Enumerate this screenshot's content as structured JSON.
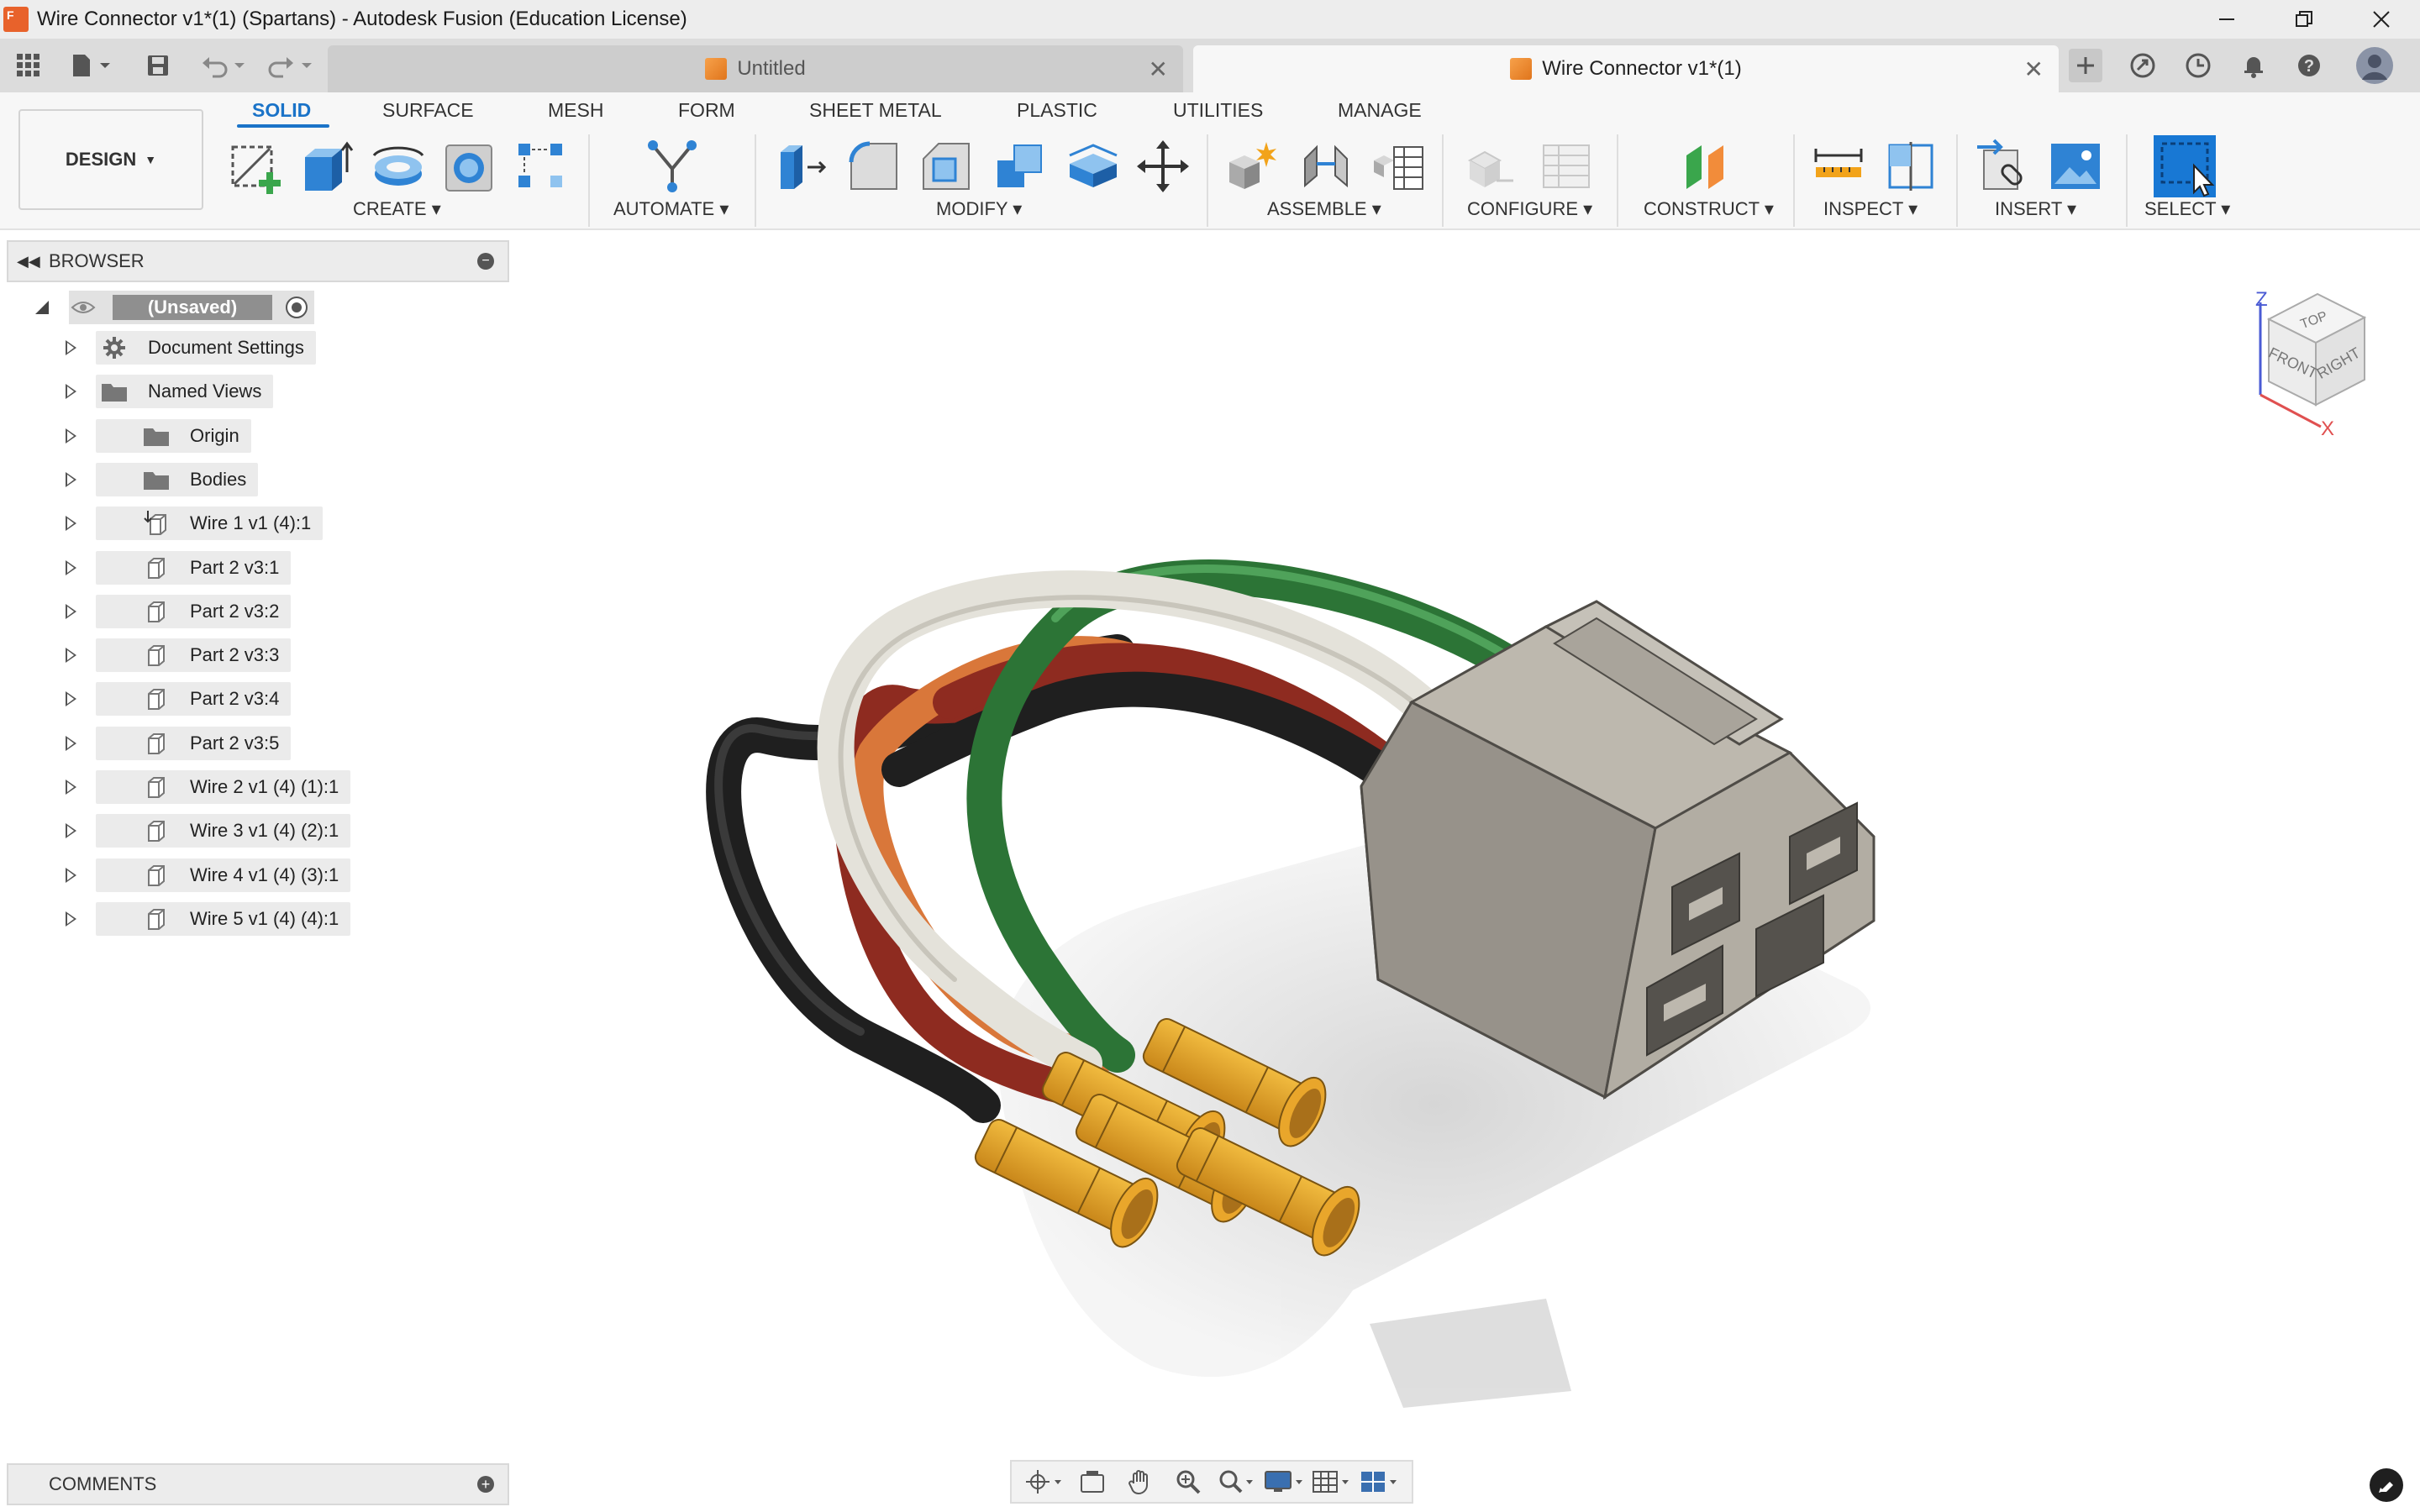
{
  "window": {
    "title": "Wire Connector v1*(1) (Spartans) - Autodesk Fusion (Education License)",
    "app_logo_text": "F",
    "controls": [
      "minimize",
      "restore",
      "close"
    ]
  },
  "document_tabs": [
    {
      "label": "Untitled",
      "active": false
    },
    {
      "label": "Wire Connector v1*(1)",
      "active": true
    }
  ],
  "quick_access": {
    "icons": [
      "app-grid-icon",
      "file-icon",
      "save-icon",
      "undo-icon",
      "redo-icon"
    ],
    "right_icons": [
      "new-tab-icon",
      "extensions-icon",
      "job-status-icon",
      "notifications-icon",
      "help-icon",
      "user-avatar"
    ]
  },
  "workspace": {
    "label": "DESIGN",
    "tabs": [
      "SOLID",
      "SURFACE",
      "MESH",
      "FORM",
      "SHEET METAL",
      "PLASTIC",
      "UTILITIES",
      "MANAGE"
    ],
    "active_tab": "SOLID"
  },
  "toolbar_groups": [
    {
      "label": "CREATE",
      "tools": [
        "create-sketch",
        "extrude",
        "revolve",
        "hole",
        "pattern"
      ]
    },
    {
      "label": "AUTOMATE",
      "tools": [
        "automate"
      ]
    },
    {
      "label": "MODIFY",
      "tools": [
        "press-pull",
        "fillet",
        "chamfer",
        "combine",
        "shell",
        "move"
      ]
    },
    {
      "label": "ASSEMBLE",
      "tools": [
        "new-component",
        "joint",
        "table"
      ]
    },
    {
      "label": "CONFIGURE",
      "tools": [
        "configure-a",
        "configure-b"
      ]
    },
    {
      "label": "CONSTRUCT",
      "tools": [
        "offset-plane"
      ]
    },
    {
      "label": "INSPECT",
      "tools": [
        "measure",
        "interference"
      ]
    },
    {
      "label": "INSERT",
      "tools": [
        "insert-derive",
        "insert-image"
      ]
    },
    {
      "label": "SELECT",
      "tools": [
        "select"
      ]
    }
  ],
  "browser": {
    "title": "BROWSER",
    "root": "(Unsaved)",
    "items": [
      {
        "label": "Document Settings",
        "icon": "gear-icon",
        "eye": false
      },
      {
        "label": "Named Views",
        "icon": "folder-icon",
        "eye": false
      },
      {
        "label": "Origin",
        "icon": "folder-icon",
        "eye": "hidden"
      },
      {
        "label": "Bodies",
        "icon": "folder-icon",
        "eye": true
      },
      {
        "label": "Wire 1 v1 (4):1",
        "icon": "component-anchored-icon",
        "eye": true
      },
      {
        "label": "Part 2 v3:1",
        "icon": "component-icon",
        "eye": true
      },
      {
        "label": "Part 2 v3:2",
        "icon": "component-icon",
        "eye": true
      },
      {
        "label": "Part 2 v3:3",
        "icon": "component-icon",
        "eye": true
      },
      {
        "label": "Part 2 v3:4",
        "icon": "component-icon",
        "eye": true
      },
      {
        "label": "Part 2 v3:5",
        "icon": "component-icon",
        "eye": true
      },
      {
        "label": "Wire 2 v1 (4) (1):1",
        "icon": "component-icon",
        "eye": true
      },
      {
        "label": "Wire 3 v1 (4) (2):1",
        "icon": "component-icon",
        "eye": true
      },
      {
        "label": "Wire 4 v1 (4) (3):1",
        "icon": "component-icon",
        "eye": true
      },
      {
        "label": "Wire 5 v1 (4) (4):1",
        "icon": "component-icon",
        "eye": true
      }
    ]
  },
  "comments": {
    "title": "COMMENTS"
  },
  "viewcube": {
    "z": "Z",
    "x": "X",
    "top": "TOP",
    "front": "FRONT",
    "right": "RIGHT"
  },
  "navbar": {
    "tools": [
      "orbit-icon",
      "look-at-icon",
      "pan-icon",
      "zoom-icon",
      "fit-icon",
      "display-settings-icon",
      "grid-icon",
      "viewports-icon"
    ]
  },
  "colors": {
    "accent": "#1a73c8",
    "wire_green": "#2f7a3a",
    "wire_white": "#e8e6de",
    "wire_black": "#2a2a2a",
    "wire_red": "#9a2f22",
    "wire_orange": "#dd7a3e",
    "terminal_yellow": "#e7a727",
    "housing_gray": "#a39e94"
  }
}
